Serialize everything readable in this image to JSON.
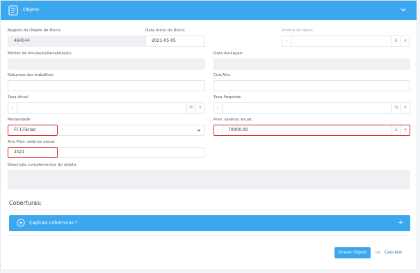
{
  "header": {
    "title": "Objeto",
    "icon": "form-icon",
    "collapse_icon": "chevron-down-icon"
  },
  "fields": {
    "registo": {
      "label": "Registo do Objeto de Risco:",
      "value": "464544"
    },
    "data_inicio": {
      "label": "Data Início do Risco:",
      "value": "2021-05-05"
    },
    "premio": {
      "label": "Prémio do Risco",
      "minus": "-",
      "unit": "€",
      "plus": "+",
      "value": ""
    },
    "motivo": {
      "label": "Motivo de Anulação/Revalidação:",
      "value": ""
    },
    "data_anulacao": {
      "label": "Data Anulação:",
      "value": ""
    },
    "natureza": {
      "label": "Natureza dos trabalhos:",
      "value": ""
    },
    "cod_ativ": {
      "label": "Cod.Ativ:",
      "value": ""
    },
    "taxa_atual": {
      "label": "Taxa Atual:",
      "minus": "-",
      "unit": "%",
      "plus": "+",
      "value": ""
    },
    "taxa_proposta": {
      "label": "Taxa Proposta:",
      "minus": "-",
      "unit": "%",
      "plus": "+",
      "value": ""
    },
    "modalidade": {
      "label": "Modalidade:",
      "value": "FF F.Férias"
    },
    "prev_salarios": {
      "label": "Prev. salários anual:",
      "minus": "-",
      "unit": "€",
      "plus": "+",
      "value": "70000.00"
    },
    "ano_prev": {
      "label": "Ano Prev. salários anual:",
      "value": "2021"
    },
    "descricao": {
      "label": "Descrição complementar do objeto:",
      "value": ""
    }
  },
  "coberturas": {
    "title": "Coberturas:",
    "bar_label": "Capitais coberturas *",
    "bar_plus": "+"
  },
  "footer": {
    "save_label": "Gravar Objeto",
    "ou": "ou",
    "cancel_label": "Cancelar"
  },
  "colors": {
    "primary": "#3ba7ef",
    "highlight": "#d9262b"
  }
}
